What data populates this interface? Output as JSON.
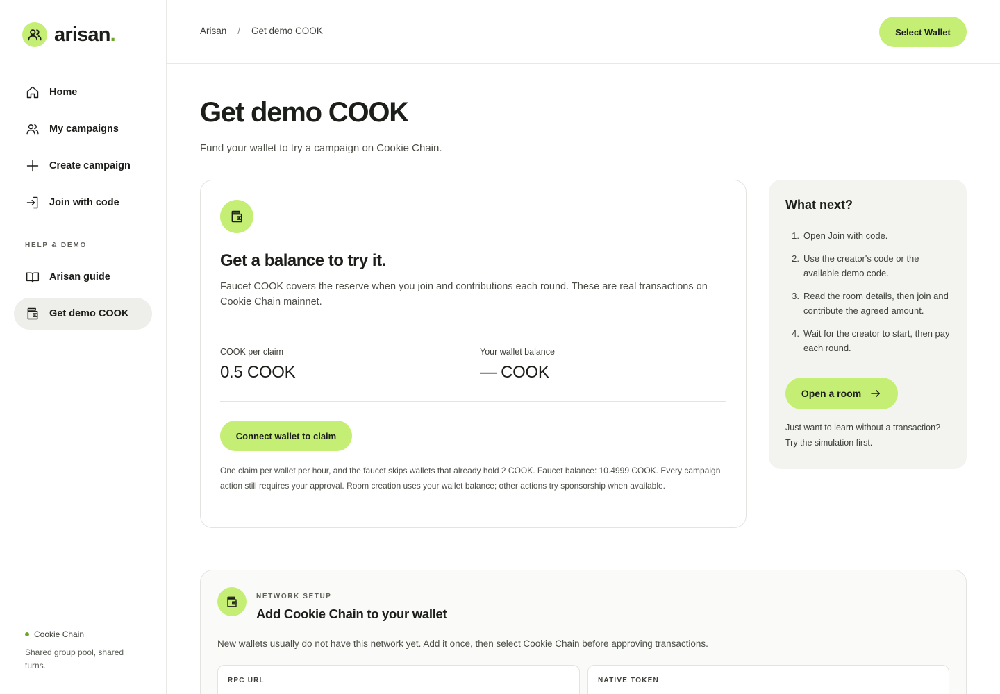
{
  "brand": {
    "name": "arisan",
    "dot": ".",
    "accent": "#c5ee74",
    "accent_dark": "#6ea52a"
  },
  "sidebar": {
    "items": [
      {
        "label": "Home",
        "icon": "home-icon"
      },
      {
        "label": "My campaigns",
        "icon": "users-icon"
      },
      {
        "label": "Create campaign",
        "icon": "plus-icon"
      },
      {
        "label": "Join with code",
        "icon": "login-icon"
      }
    ],
    "section_label": "HELP & DEMO",
    "help_items": [
      {
        "label": "Arisan guide",
        "icon": "book-icon"
      },
      {
        "label": "Get demo COOK",
        "icon": "wallet-icon",
        "active": true
      }
    ],
    "chain": {
      "name": "Cookie Chain",
      "description": "Shared group pool, shared turns."
    }
  },
  "header": {
    "breadcrumb": [
      "Arisan",
      "Get demo COOK"
    ],
    "breadcrumb_sep": "/",
    "wallet_button": "Select Wallet"
  },
  "page": {
    "title": "Get demo COOK",
    "subtitle": "Fund your wallet to try a campaign on Cookie Chain."
  },
  "faucet": {
    "title": "Get a balance to try it.",
    "description": "Faucet COOK covers the reserve when you join and contributions each round. These are real transactions on Cookie Chain mainnet.",
    "per_claim_label": "COOK per claim",
    "per_claim_value": "0.5 COOK",
    "balance_label": "Your wallet balance",
    "balance_value": "— COOK",
    "claim_button": "Connect wallet to claim",
    "fine_print": "One claim per wallet per hour, and the faucet skips wallets that already hold 2 COOK. Faucet balance: 10.4999 COOK. Every campaign action still requires your approval. Room creation uses your wallet balance; other actions try sponsorship when available."
  },
  "next": {
    "title": "What next?",
    "steps": [
      {
        "num": "1.",
        "text": "Open Join with code."
      },
      {
        "num": "2.",
        "text": "Use the creator's code or the available demo code."
      },
      {
        "num": "3.",
        "text": "Read the room details, then join and contribute the agreed amount."
      },
      {
        "num": "4.",
        "text": "Wait for the creator to start, then pay each round."
      }
    ],
    "button": "Open a room",
    "learn_text": "Just want to learn without a transaction?",
    "learn_link": "Try the simulation first."
  },
  "network": {
    "eyebrow": "NETWORK SETUP",
    "title": "Add Cookie Chain to your wallet",
    "description": "New wallets usually do not have this network yet. Add it once, then select Cookie Chain before approving transactions.",
    "rpc_label": "RPC URL",
    "token_label": "NATIVE TOKEN"
  }
}
